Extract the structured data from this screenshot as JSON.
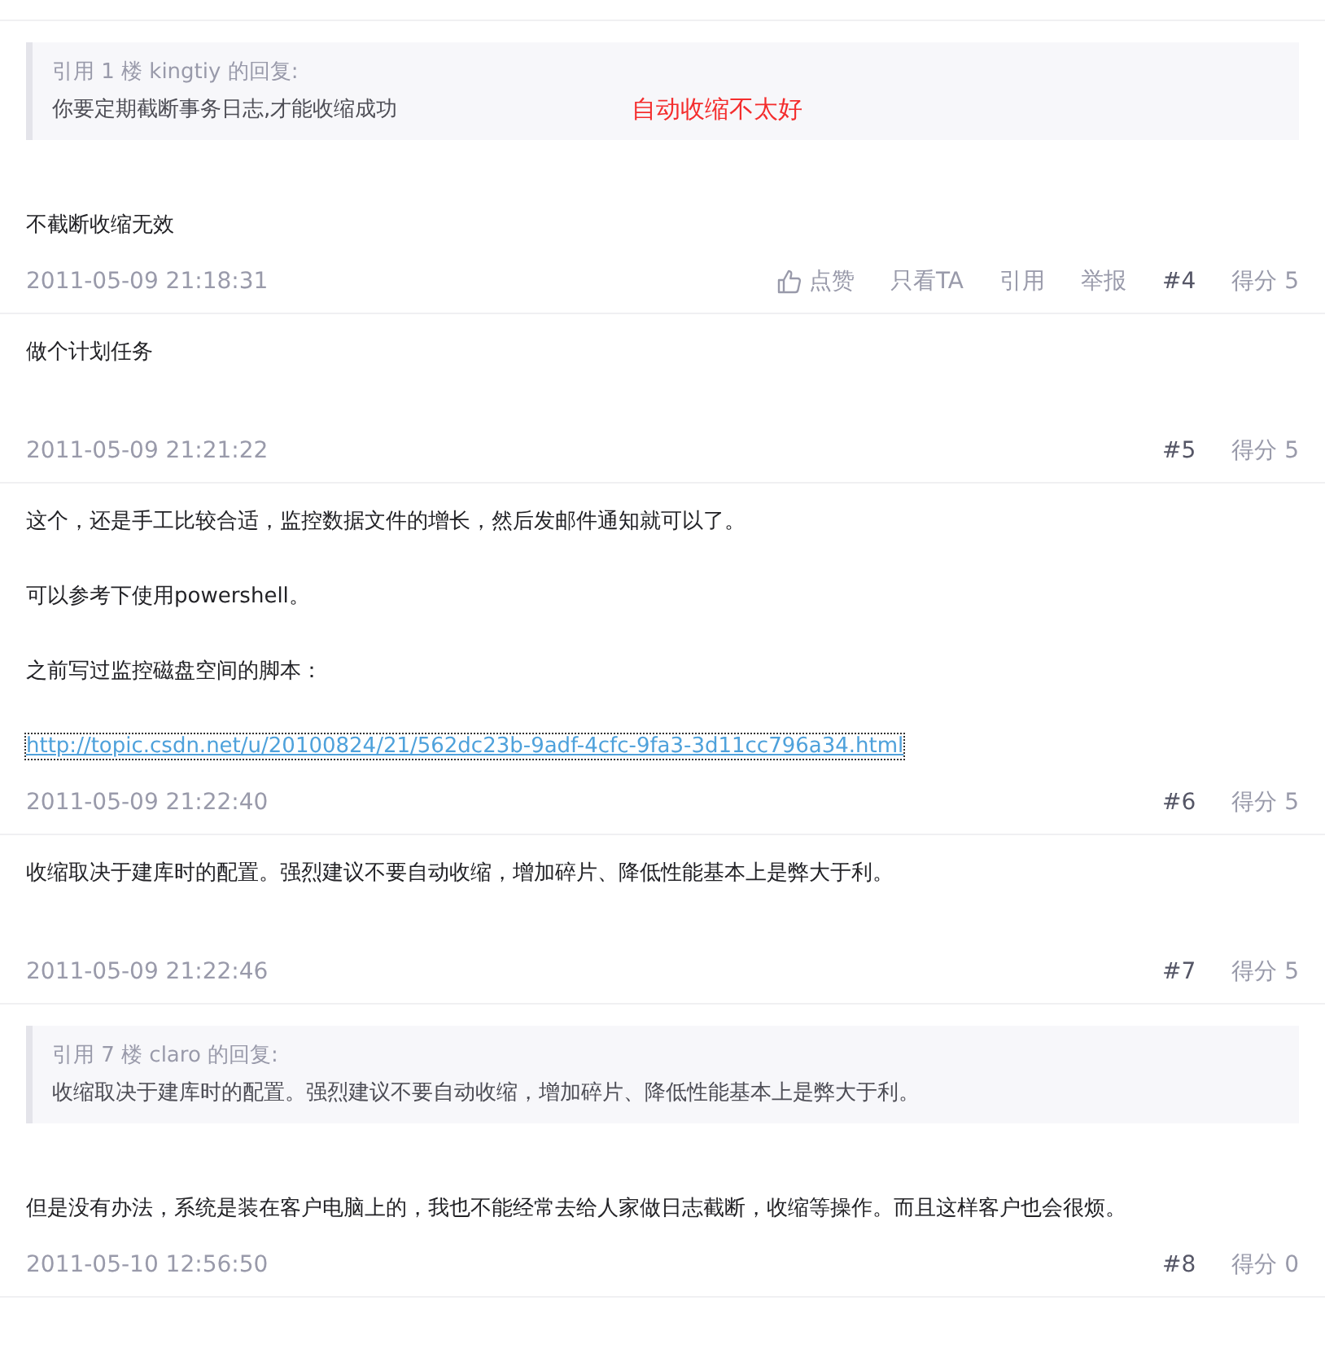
{
  "posts": [
    {
      "quote": {
        "header": "引用 1 楼 kingtiy 的回复:",
        "text": "你要定期截断事务日志,才能收缩成功"
      },
      "annotation": "自动收缩不太好",
      "paragraphs": [
        {
          "kind": "text",
          "text": "不截断收缩无效"
        }
      ],
      "date": "2011-05-09 21:18:31",
      "actions": [
        "点赞",
        "只看TA",
        "引用",
        "举报"
      ],
      "floor": "#4",
      "score": "得分 5"
    },
    {
      "paragraphs": [
        {
          "kind": "text",
          "text": "做个计划任务"
        }
      ],
      "date": "2011-05-09 21:21:22",
      "floor": "#5",
      "score": "得分 5"
    },
    {
      "paragraphs": [
        {
          "kind": "text",
          "text": "这个，还是手工比较合适，监控数据文件的增长，然后发邮件通知就可以了。"
        },
        {
          "kind": "text",
          "text": "可以参考下使用powershell。"
        },
        {
          "kind": "text",
          "text": "之前写过监控磁盘空间的脚本："
        },
        {
          "kind": "link",
          "text": "http://topic.csdn.net/u/20100824/21/562dc23b-9adf-4cfc-9fa3-3d11cc796a34.html"
        }
      ],
      "date": "2011-05-09 21:22:40",
      "floor": "#6",
      "score": "得分 5"
    },
    {
      "paragraphs": [
        {
          "kind": "text",
          "text": "收缩取决于建库时的配置。强烈建议不要自动收缩，增加碎片、降低性能基本上是弊大于利。"
        }
      ],
      "date": "2011-05-09 21:22:46",
      "floor": "#7",
      "score": "得分 5"
    },
    {
      "quote": {
        "header": "引用 7 楼 claro 的回复:",
        "text": "收缩取决于建库时的配置。强烈建议不要自动收缩，增加碎片、降低性能基本上是弊大于利。"
      },
      "paragraphs": [
        {
          "kind": "text",
          "text": "但是没有办法，系统是装在客户电脑上的，我也不能经常去给人家做日志截断，收缩等操作。而且这样客户也会很烦。"
        }
      ],
      "date": "2011-05-10 12:56:50",
      "floor": "#8",
      "score": "得分 0"
    }
  ]
}
